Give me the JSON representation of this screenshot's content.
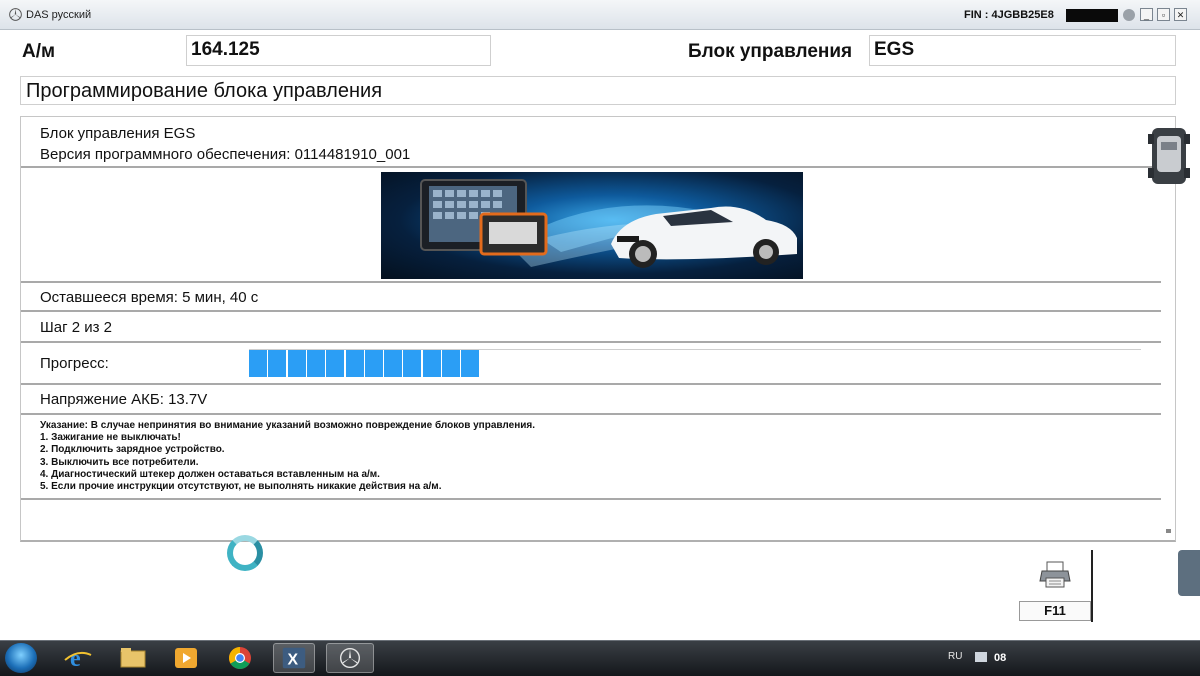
{
  "window": {
    "app_title": "DAS русский",
    "fin_text": "FIN : 4JGBB25E8",
    "buttons": {
      "minimize": "_",
      "restore": "▫",
      "close": "✕"
    }
  },
  "header": {
    "vehicle_label": "А/м",
    "vehicle_value": "164.125",
    "control_unit_label": "Блок управления",
    "control_unit_value": "EGS"
  },
  "page_title": "Программирование блока управления",
  "info": {
    "unit_line": "Блок управления EGS",
    "software_line": "Версия программного обеспечения: 0114481910_001"
  },
  "status": {
    "time_remaining": "Оставшееся время: 5 мин, 40 с",
    "step": "Шаг 2 из 2",
    "progress_label": "Прогресс:",
    "progress_fraction": 0.26,
    "progress_segments": 12,
    "battery_voltage": "Напряжение АКБ: 13.7V"
  },
  "notes": {
    "lines": [
      "Указание:  В случае непринятия во внимание указаний возможно повреждение блоков управления.",
      "1. Зажигание не выключать!",
      "2. Подключить зарядное устройство.",
      "3. Выключить все потребители.",
      "4. Диагностический штекер должен оставаться вставленным на а/м.",
      "5. Если прочие инструкции отсутствуют, не выполнять никакие действия на а/м."
    ]
  },
  "print_button": {
    "label": "F11",
    "icon": "printer-icon"
  },
  "taskbar": {
    "language": "RU",
    "clock_fragment": "08",
    "apps": [
      "internet-explorer-icon",
      "file-explorer-icon",
      "media-player-icon",
      "chrome-icon",
      "xentry-icon",
      "mercedes-star-icon"
    ]
  },
  "colors": {
    "progress_fill": "#2b9ef5",
    "spinner": "#3fb3c4",
    "taskbar": "#1e2227"
  }
}
